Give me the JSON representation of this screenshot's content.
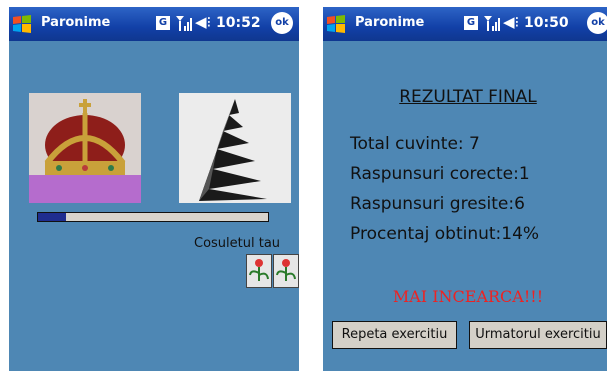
{
  "left_screen": {
    "title": "Paronime",
    "time": "10:52",
    "ok": "ok",
    "gprs": "G",
    "progress_fraction": 0.12,
    "basket_label": "Cosuletul tau",
    "images": [
      "crown-picture",
      "spiral-tower-picture"
    ]
  },
  "right_screen": {
    "title": "Paronime",
    "time": "10:50",
    "ok": "ok",
    "gprs": "G",
    "result_title": "REZULTAT FINAL",
    "stats": [
      "Total cuvinte: 7",
      "Raspunsuri corecte:1",
      "Raspunsuri gresite:6",
      "Procentaj obtinut:14%"
    ],
    "message": "MAI INCEARCA!!!",
    "buttons": [
      "Repeta exercitiu",
      "Urmatorul exercitiu"
    ]
  },
  "colors": {
    "background": "#4e87b4",
    "titlebar": "#1240a7",
    "message": "#ee2222",
    "progress": "#1f2d8f"
  }
}
